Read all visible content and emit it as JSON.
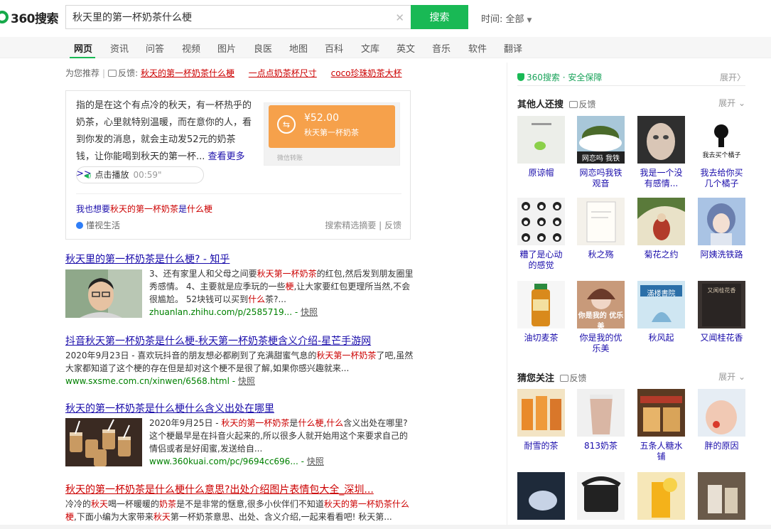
{
  "logo": {
    "text": "360搜索"
  },
  "search": {
    "query": "秋天里的第一杯奶茶什么梗",
    "button_label": "搜索",
    "clear_icon": "close-icon"
  },
  "time_filter": {
    "label": "时间:",
    "value": "全部"
  },
  "nav": {
    "items": [
      {
        "label": "网页",
        "active": true
      },
      {
        "label": "资讯"
      },
      {
        "label": "问答"
      },
      {
        "label": "视频"
      },
      {
        "label": "图片"
      },
      {
        "label": "良医"
      },
      {
        "label": "地图"
      },
      {
        "label": "百科"
      },
      {
        "label": "文库"
      },
      {
        "label": "英文"
      },
      {
        "label": "音乐"
      },
      {
        "label": "软件"
      },
      {
        "label": "翻译"
      }
    ]
  },
  "hints": {
    "prefix": "为您推荐",
    "feedback": "反馈",
    "links": [
      "秋天的第一杯奶茶什么梗",
      "一点点奶茶杯尺寸",
      "coco珍珠奶茶大杯"
    ]
  },
  "answer_card": {
    "text": "指的是在这个有点冷的秋天，有一杯热乎的奶茶，心里就特别温暖，而在意你的人，看到你发的消息，就会主动发52元的奶茶钱，让你能喝到秋天的第一杯...",
    "more_link": "查看更多>>",
    "play_label": "点击播放",
    "play_duration": "00:59\"",
    "image": {
      "amount": "¥52.00",
      "desc": "秋天第一杯奶茶",
      "foot": "微信转账"
    },
    "also_want": {
      "prefix": "我也想要",
      "em": "秋天的第一杯奶茶",
      "mid": "是",
      "em2": "什么梗"
    },
    "source": "懂视生活",
    "tools": "搜索精选摘要 | 反馈"
  },
  "results": [
    {
      "title": "秋天里的第一杯奶茶是什么梗? - 知乎",
      "snippet_parts": [
        {
          "t": "3、还有家里人和父母之间要"
        },
        {
          "t": "秋天第一杯奶茶",
          "em": true
        },
        {
          "t": "的红包,然后发到朋友圈里秀感情。 4、主要就是应季玩的一些"
        },
        {
          "t": "梗",
          "em": true
        },
        {
          "t": ",让大家要红包更理所当然,不会很尴尬。 52块钱可以买到"
        },
        {
          "t": "什么",
          "em": true
        },
        {
          "t": "茶?..."
        }
      ],
      "url": "zhuanlan.zhihu.com/p/2585719...",
      "snapshot": "快照"
    },
    {
      "title": "抖音秋天第一杯奶茶是什么梗-秋天第一杯奶茶梗含义介绍-星芒手游网",
      "snippet_parts": [
        {
          "t": "2020年9月23日 - 喜欢玩抖音的朋友想必都刷到了充满甜蜜气息的"
        },
        {
          "t": "秋天第一杯奶茶",
          "em": true
        },
        {
          "t": "了吧,虽然大家都知道了这个梗的存在但是却对这个梗不是很了解,如果你感兴趣就来..."
        }
      ],
      "url": "www.sxsme.com.cn/xinwen/6568.html",
      "snapshot": "快照"
    },
    {
      "title": "秋天的第一杯奶茶是什么梗什么含义出处在哪里",
      "snippet_parts": [
        {
          "t": "2020年9月25日 - "
        },
        {
          "t": "秋天的第一杯奶茶",
          "em": true
        },
        {
          "t": "是"
        },
        {
          "t": "什么梗",
          "em": true
        },
        {
          "t": ","
        },
        {
          "t": "什么",
          "em": true
        },
        {
          "t": "含义出处在哪里?这个梗最早是在抖音火起来的,所以很多人就开始用这个来要求自己的情侣或者是好闺蜜,发送给自..."
        }
      ],
      "url": "www.360kuai.com/pc/9694cc696...",
      "snapshot": "快照"
    },
    {
      "title": "秋天的第一杯奶茶是什么梗什么意思?出处介绍图片表情包大全_深圳...",
      "snippet_parts": [
        {
          "t": "冷冷的"
        },
        {
          "t": "秋天",
          "em": true
        },
        {
          "t": "喝一杯暖暖的"
        },
        {
          "t": "奶茶",
          "em": true
        },
        {
          "t": "是不是非常的惬意,很多小伙伴们不知道"
        },
        {
          "t": "秋天的第一杯奶茶什么梗",
          "em": true
        },
        {
          "t": ",下面小编为大家带来"
        },
        {
          "t": "秋天",
          "em": true
        },
        {
          "t": "第一杯奶茶意思、出处、含义介绍,一起来看看吧! 秋天第..."
        }
      ]
    }
  ],
  "right": {
    "safe": {
      "label": "360搜索 · 安全保障",
      "expand": "展开"
    },
    "others_search": {
      "title": "其他人还搜",
      "feedback": "反馈",
      "expand": "展开",
      "items": [
        {
          "label": "原谅帽"
        },
        {
          "label": "网恋吗我铁观音",
          "overlay": "网恋吗 我铁"
        },
        {
          "label": "我是一个没有感情..."
        },
        {
          "label": "我去给你买几个橘子",
          "overlay": "我去买个橘子"
        },
        {
          "label": "糟了是心动的感觉"
        },
        {
          "label": "秋之殇"
        },
        {
          "label": "菊花之约"
        },
        {
          "label": "阿姨洗铁路"
        },
        {
          "label": "油切麦茶"
        },
        {
          "label": "你是我的优乐美",
          "overlay": "你是我的 优乐美"
        },
        {
          "label": "秋风起",
          "overlay": "滿楼書院"
        },
        {
          "label": "又闻桂花香",
          "overlay": "又闻桂花香"
        }
      ]
    },
    "guess": {
      "title": "猜您关注",
      "feedback": "反馈",
      "expand": "展开",
      "items": [
        {
          "label": "耐雪的茶"
        },
        {
          "label": "813奶茶"
        },
        {
          "label": "五条人糖水铺"
        },
        {
          "label": "胖的原因"
        },
        {
          "label": ""
        },
        {
          "label": ""
        },
        {
          "label": ""
        },
        {
          "label": ""
        }
      ]
    }
  }
}
